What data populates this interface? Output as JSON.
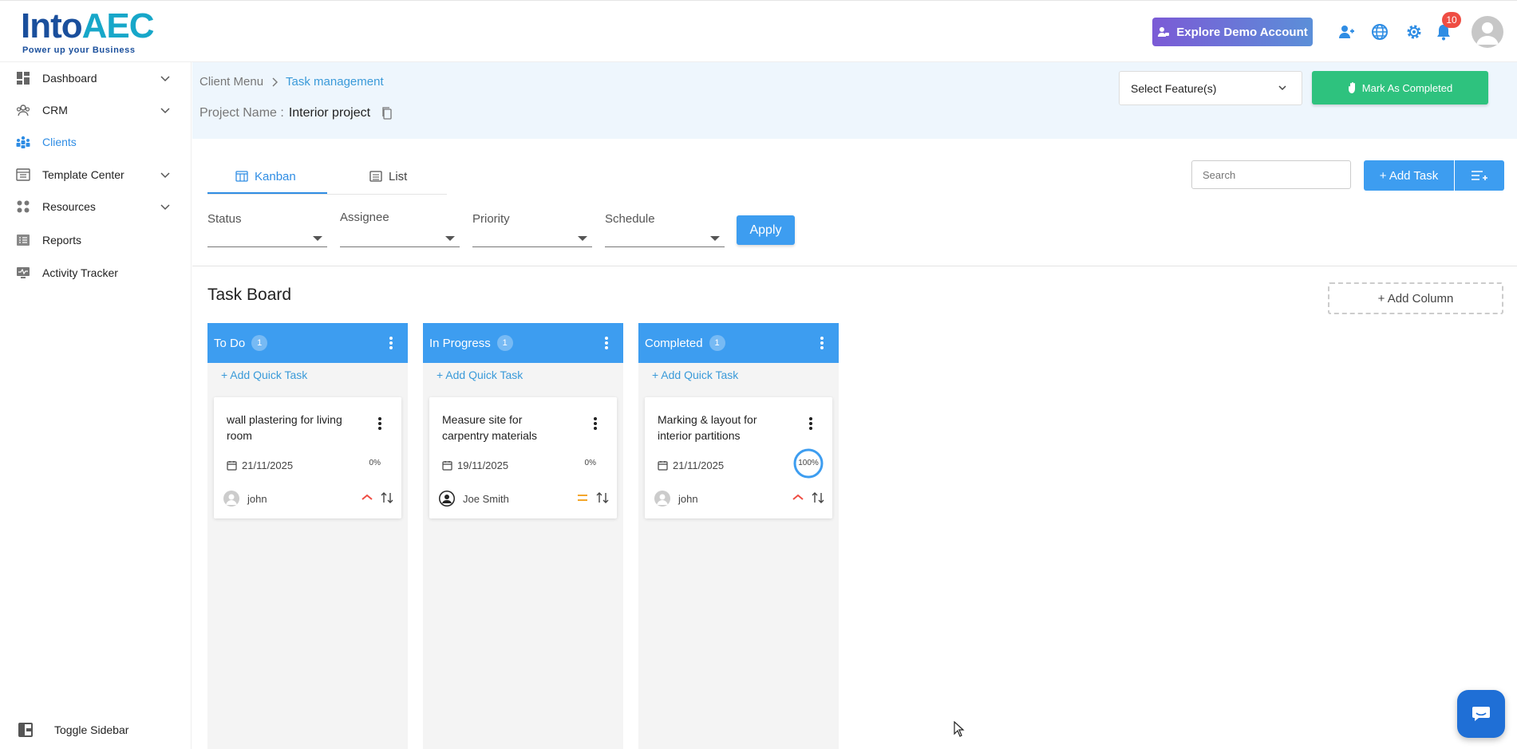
{
  "header": {
    "logo_main": "Into",
    "logo_accent": "AEC",
    "logo_tagline": "Power up your Business",
    "demo_button": "Explore Demo Account",
    "notification_count": "10"
  },
  "sidebar": {
    "items": [
      {
        "label": "Dashboard",
        "icon": "dashboard-icon"
      },
      {
        "label": "CRM",
        "icon": "crm-icon"
      },
      {
        "label": "Clients",
        "icon": "clients-icon"
      },
      {
        "label": "Template Center",
        "icon": "template-icon"
      },
      {
        "label": "Resources",
        "icon": "resources-icon"
      },
      {
        "label": "Reports",
        "icon": "reports-icon"
      },
      {
        "label": "Activity Tracker",
        "icon": "activity-icon"
      }
    ],
    "toggle_label": "Toggle Sidebar"
  },
  "breadcrumb": {
    "parent": "Client Menu",
    "current": "Task management"
  },
  "project": {
    "label": "Project Name :",
    "name": "Interior project"
  },
  "feature_select": {
    "value": "Select Feature(s)"
  },
  "mark_completed": "Mark As Completed",
  "tabs": [
    {
      "label": "Kanban"
    },
    {
      "label": "List"
    }
  ],
  "search": {
    "placeholder": "Search"
  },
  "add_task": "+ Add Task",
  "filters": [
    {
      "label": "Status"
    },
    {
      "label": "Assignee"
    },
    {
      "label": "Priority"
    },
    {
      "label": "Schedule"
    }
  ],
  "apply": "Apply",
  "board": {
    "title": "Task Board",
    "add_column": "+ Add Column",
    "quick_add": "+ Add Quick Task",
    "columns": [
      {
        "name": "To Do",
        "count": "1",
        "card": {
          "title": "wall plastering for living room",
          "date": "21/11/2025",
          "progress": "0%",
          "assignee": "john",
          "priority": "high"
        }
      },
      {
        "name": "In Progress",
        "count": "1",
        "card": {
          "title": "Measure site for carpentry materials",
          "date": "19/11/2025",
          "progress": "0%",
          "assignee": "Joe Smith",
          "priority": "medium"
        }
      },
      {
        "name": "Completed",
        "count": "1",
        "card": {
          "title": "Marking & layout for interior partitions",
          "date": "21/11/2025",
          "progress": "100%",
          "assignee": "john",
          "priority": "high"
        }
      }
    ]
  },
  "colors": {
    "primary": "#3d9df0",
    "success": "#2ec27e",
    "danger": "#ef4d43",
    "medium": "#f3a62b"
  }
}
